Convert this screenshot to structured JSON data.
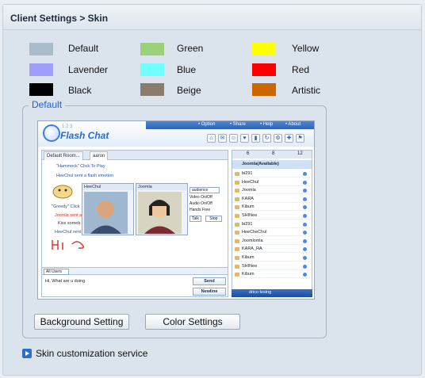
{
  "header": {
    "title": "Client Settings   > Skin"
  },
  "swatches": [
    {
      "label": "Default",
      "color": "#a9bcca"
    },
    {
      "label": "Green",
      "color": "#9dd07a"
    },
    {
      "label": "Yellow",
      "color": "#ffff00"
    },
    {
      "label": "Lavender",
      "color": "#9f9ffb"
    },
    {
      "label": "Blue",
      "color": "#70ffff"
    },
    {
      "label": "Red",
      "color": "#ff0000"
    },
    {
      "label": "Black",
      "color": "#000000"
    },
    {
      "label": "Beige",
      "color": "#8a7c6c"
    },
    {
      "label": "Artistic",
      "color": "#cc6600"
    }
  ],
  "group": {
    "legend": "Default"
  },
  "preview": {
    "menu": [
      "• Option",
      "• Share",
      "• Help",
      "• About"
    ],
    "logo_num": "1 2 3",
    "logo": "Flash Chat",
    "tabs": [
      "Default Room...",
      "aaron"
    ],
    "chat_lines": [
      "\"Hammock\"  Click To Play",
      "HeeChul sent a flash emotion",
      "\"Greedy\"  Click",
      "Joomla sent a",
      "Kiss someb",
      "HeeChul sent a"
    ],
    "cams": [
      "HeeChul",
      "Joomla"
    ],
    "options": [
      "audience",
      "Video On/Off",
      "Audio On/Off",
      "Hands Free",
      "Talk",
      "Stop"
    ],
    "input_select": "All Users",
    "input_text": "Hi, What are u doing",
    "send": "Send",
    "newline": "Newline",
    "right_tabs": [
      "6",
      "8",
      "12"
    ],
    "owner": "Joomla(Available)",
    "users": [
      "bi291",
      "HeeChul",
      "Joomla",
      "KARA",
      "Kibum",
      "SHINee",
      "bi291",
      "HeeCheChul",
      "Joomlomla",
      "KARA_RA",
      "Kibum",
      "SHINee",
      "Kibum"
    ],
    "bottom_text": "drico tesing"
  },
  "buttons": {
    "background": "Background Setting",
    "color": "Color Settings"
  },
  "link": {
    "label": "Skin customization service",
    "icon": "play-icon"
  },
  "colors": {
    "accent": "#1e63c8",
    "frame_bg": "#dbe3ec"
  }
}
